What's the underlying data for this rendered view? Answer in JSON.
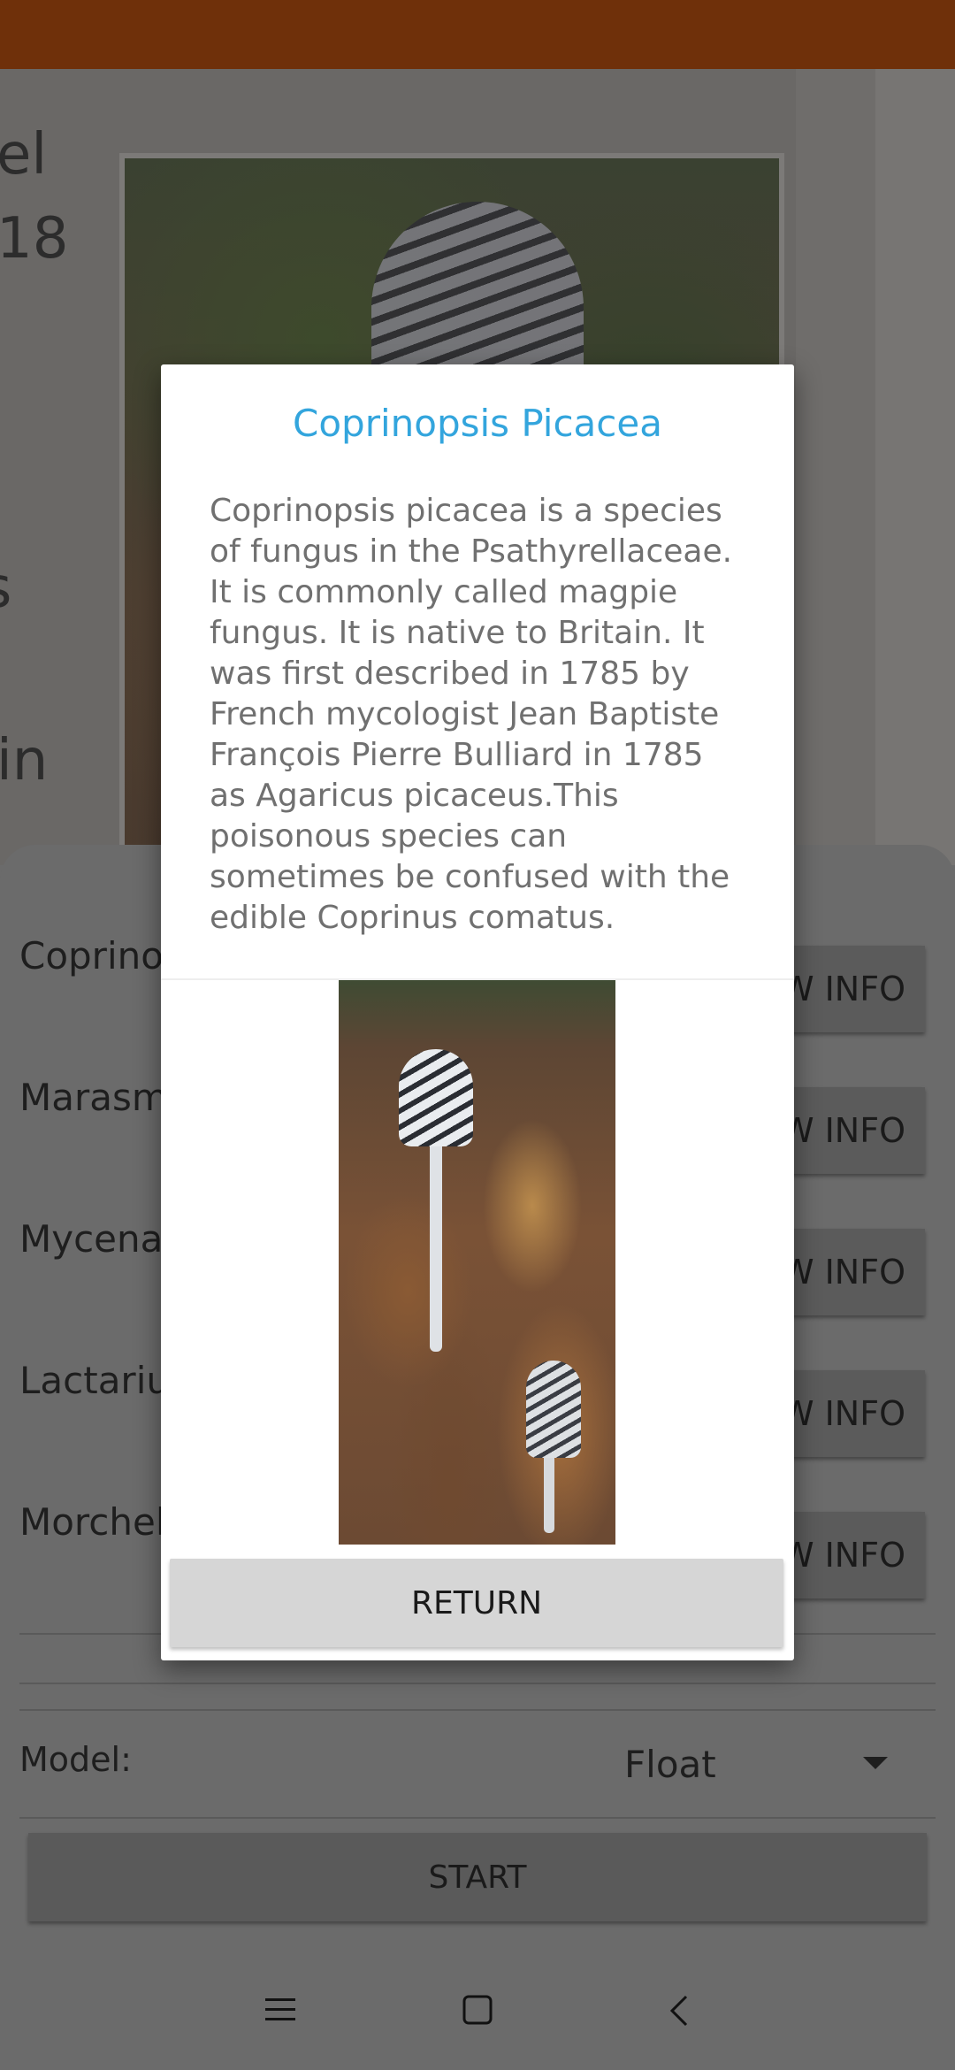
{
  "dialog": {
    "title": "Coprinopsis Picacea",
    "description": "Coprinopsis picacea is a species of fungus in the Psathyrellaceae. It is commonly called magpie fungus. It is native to Britain. It was first described in 1785 by French mycologist Jean Baptiste François Pierre Bulliard in 1785 as Agaricus picaceus.This poisonous species can sometimes be confused with the edible Coprinus comatus.",
    "return_label": "RETURN"
  },
  "camera": {
    "text_1": "el",
    "text_2": "18",
    "text_3": "s",
    "text_4": "in"
  },
  "results": [
    {
      "name": "Coprinop",
      "button": "W INFO"
    },
    {
      "name": "Marasm",
      "button": "W INFO"
    },
    {
      "name": "Mycena",
      "button": "W INFO"
    },
    {
      "name": "Lactariu",
      "button": "W INFO"
    },
    {
      "name": "Morchel",
      "button": "W INFO"
    }
  ],
  "model": {
    "label": "Model:",
    "value": "Float"
  },
  "start_label": "START",
  "navbar": {
    "menu_icon": "menu-icon",
    "home_icon": "home-icon",
    "back_icon": "back-icon"
  },
  "colors": {
    "status_bar": "#6f300a",
    "dialog_title": "#33a5dd",
    "scrim_background": "#6b6b6b"
  }
}
